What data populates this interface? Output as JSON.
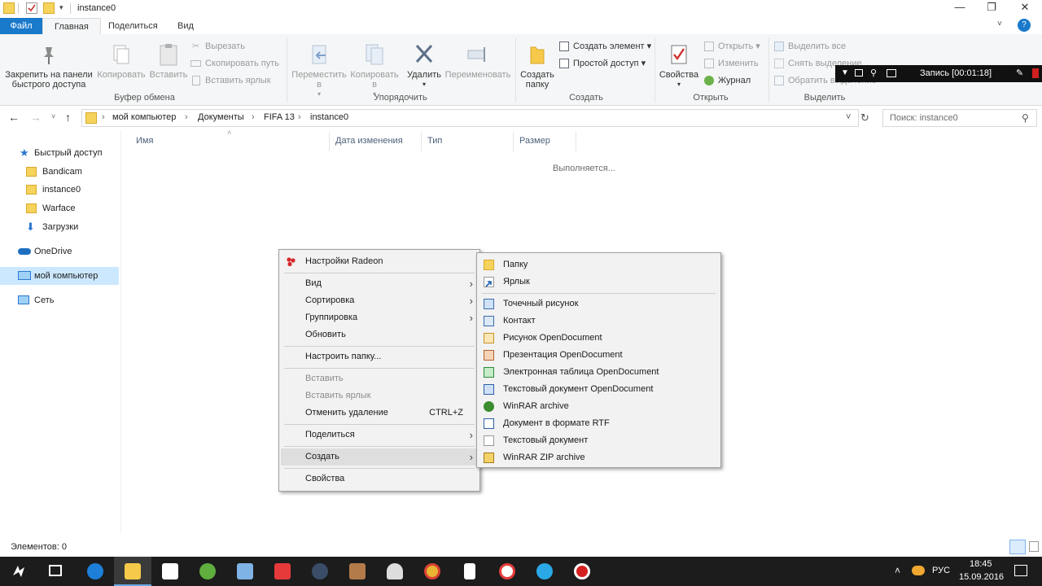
{
  "window": {
    "title": "instance0",
    "minimize": "—",
    "maximize": "❐",
    "close": "✕",
    "help": "?"
  },
  "ribbon_tabs": [
    "Файл",
    "Главная",
    "Поделиться",
    "Вид"
  ],
  "ribbon": {
    "clipboard": {
      "pin": "Закрепить на панели быстрого доступа",
      "copy": "Копировать",
      "paste": "Вставить",
      "cut": "Вырезать",
      "copy_path": "Скопировать путь",
      "paste_shortcut": "Вставить ярлык",
      "label": "Буфер обмена"
    },
    "organize": {
      "move": "Переместить в",
      "copy_to": "Копировать в",
      "delete": "Удалить",
      "rename": "Переименовать",
      "label": "Упорядочить"
    },
    "create": {
      "new_folder": "Создать папку",
      "new_item": "Создать элемент",
      "easy_access": "Простой доступ",
      "label": "Создать"
    },
    "open": {
      "properties": "Свойства",
      "open": "Открыть",
      "edit": "Изменить",
      "history": "Журнал",
      "label": "Открыть"
    },
    "select": {
      "select_all": "Выделить все",
      "select_none": "Снять выделение",
      "invert": "Обратить выделение",
      "label": "Выделить"
    }
  },
  "recorder": {
    "text": "Запись [00:01:18]"
  },
  "address": {
    "crumbs": [
      "мой компьютер",
      "Документы",
      "FIFA 13",
      "instance0"
    ],
    "search_placeholder": "Поиск: instance0"
  },
  "nav": {
    "quick_access": "Быстрый доступ",
    "pinned": [
      "Bandicam",
      "instance0",
      "Warface",
      "Загрузки"
    ],
    "onedrive": "OneDrive",
    "this_pc": "мой компьютер",
    "network": "Сеть"
  },
  "columns": [
    "Имя",
    "Дата изменения",
    "Тип",
    "Размер"
  ],
  "loading": "Выполняется...",
  "context_menu": {
    "radeon": "Настройки Radeon",
    "view": "Вид",
    "sort": "Сортировка",
    "group": "Группировка",
    "refresh": "Обновить",
    "customize": "Настроить папку...",
    "paste": "Вставить",
    "paste_shortcut": "Вставить ярлык",
    "undo": "Отменить удаление",
    "undo_shortcut": "CTRL+Z",
    "share": "Поделиться",
    "create": "Создать",
    "properties": "Свойства"
  },
  "submenu": {
    "items": [
      "Папку",
      "Ярлык",
      "Точечный рисунок",
      "Контакт",
      "Рисунок OpenDocument",
      "Презентация OpenDocument",
      "Электронная таблица OpenDocument",
      "Текстовый документ OpenDocument",
      "WinRAR archive",
      "Документ в формате RTF",
      "Текстовый документ",
      "WinRAR ZIP archive"
    ]
  },
  "status": {
    "items": "Элементов: 0"
  },
  "tray": {
    "lang": "РУС",
    "time": "18:45",
    "date": "15.09.2016"
  },
  "colors": {
    "accent": "#1979ca",
    "selection": "#cce8ff",
    "taskbar": "#1c1c1c"
  }
}
